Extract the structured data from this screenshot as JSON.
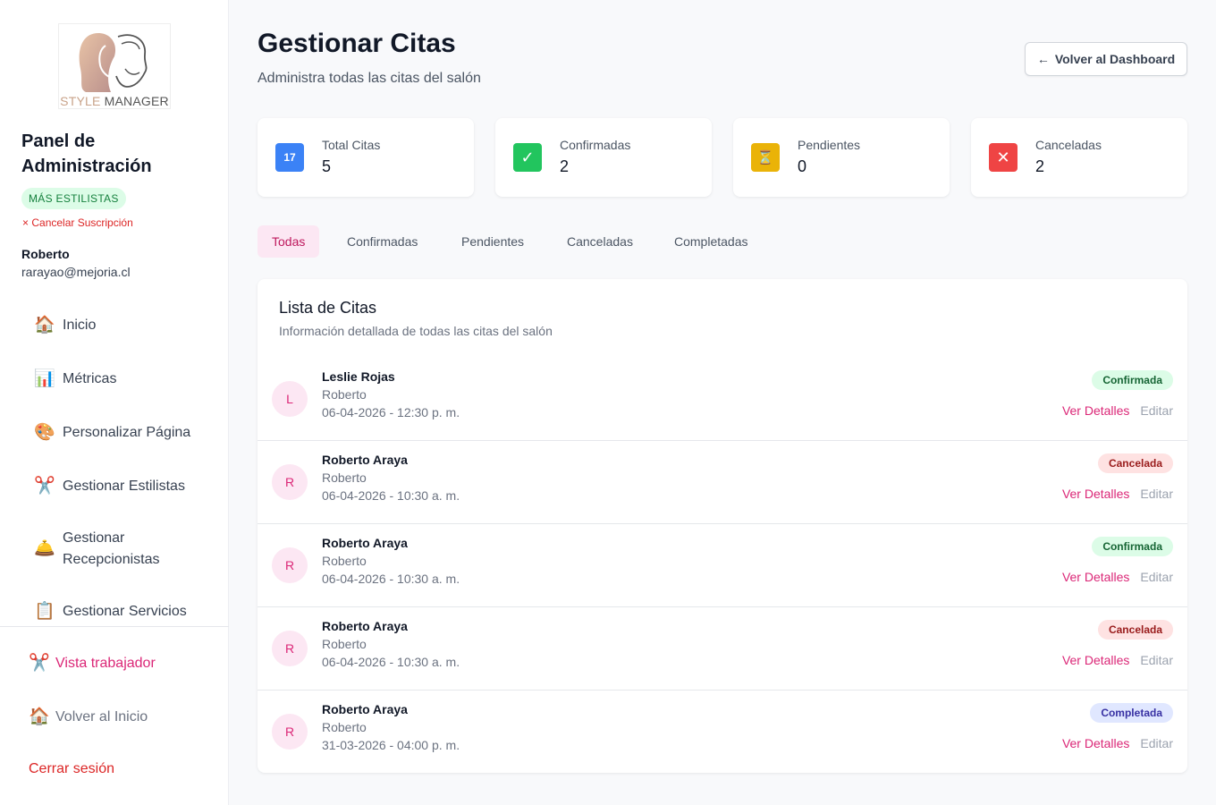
{
  "sidebar": {
    "logo": {
      "text_a": "STYLE",
      "text_b": " MANAGER"
    },
    "panel_title": "Panel de Administración",
    "plan_badge": "MÁS ESTILISTAS",
    "cancel_subscription": "Cancelar Suscripción",
    "user": {
      "name": "Roberto",
      "email": "rarayao@mejoria.cl"
    },
    "nav": [
      {
        "icon": "🏠",
        "icon_name": "house-icon",
        "label": "Inicio"
      },
      {
        "icon": "📊",
        "icon_name": "bar-chart-icon",
        "label": "Métricas"
      },
      {
        "icon": "🎨",
        "icon_name": "palette-icon",
        "label": "Personalizar Página"
      },
      {
        "icon": "✂️",
        "icon_name": "scissors-icon",
        "label": "Gestionar Estilistas"
      },
      {
        "icon": "🛎️",
        "icon_name": "bell-icon",
        "label": "Gestionar Recepcionistas"
      },
      {
        "icon": "📋",
        "icon_name": "clipboard-icon",
        "label": "Gestionar Servicios"
      }
    ],
    "worker_view": {
      "icon": "✂️",
      "label": "Vista trabajador"
    },
    "back_home": {
      "icon": "🏠",
      "label": "Volver al Inicio"
    },
    "logout": "Cerrar sesión"
  },
  "header": {
    "title": "Gestionar Citas",
    "subtitle": "Administra todas las citas del salón",
    "back_button": "Volver al Dashboard"
  },
  "stats": [
    {
      "icon": "17",
      "icon_name": "calendar-icon",
      "color": "#3b82f6",
      "label": "Total Citas",
      "value": "5"
    },
    {
      "icon": "✓",
      "icon_name": "check-box-icon",
      "color": "#22c55e",
      "label": "Confirmadas",
      "value": "2"
    },
    {
      "icon": "⏳",
      "icon_name": "hourglass-icon",
      "color": "#eab308",
      "label": "Pendientes",
      "value": "0"
    },
    {
      "icon": "✕",
      "icon_name": "cross-icon",
      "color": "#ef4444",
      "label": "Canceladas",
      "value": "2"
    }
  ],
  "tabs": [
    "Todas",
    "Confirmadas",
    "Pendientes",
    "Canceladas",
    "Completadas"
  ],
  "list": {
    "title": "Lista de Citas",
    "subtitle": "Información detallada de todas las citas del salón",
    "details_label": "Ver Detalles",
    "edit_label": "Editar",
    "rows": [
      {
        "initial": "L",
        "client": "Leslie Rojas",
        "stylist": "Roberto",
        "datetime": "06-04-2026 - 12:30 p. m.",
        "status": "Confirmada"
      },
      {
        "initial": "R",
        "client": "Roberto Araya",
        "stylist": "Roberto",
        "datetime": "06-04-2026 - 10:30 a. m.",
        "status": "Cancelada"
      },
      {
        "initial": "R",
        "client": "Roberto Araya",
        "stylist": "Roberto",
        "datetime": "06-04-2026 - 10:30 a. m.",
        "status": "Confirmada"
      },
      {
        "initial": "R",
        "client": "Roberto Araya",
        "stylist": "Roberto",
        "datetime": "06-04-2026 - 10:30 a. m.",
        "status": "Cancelada"
      },
      {
        "initial": "R",
        "client": "Roberto Araya",
        "stylist": "Roberto",
        "datetime": "31-03-2026 - 04:00 p. m.",
        "status": "Completada"
      }
    ]
  },
  "colors": {
    "accent": "#db2777",
    "danger": "#dc2626",
    "confirmed": "#dcfce7",
    "cancelled": "#fee2e2",
    "completed": "#e0e7ff"
  }
}
